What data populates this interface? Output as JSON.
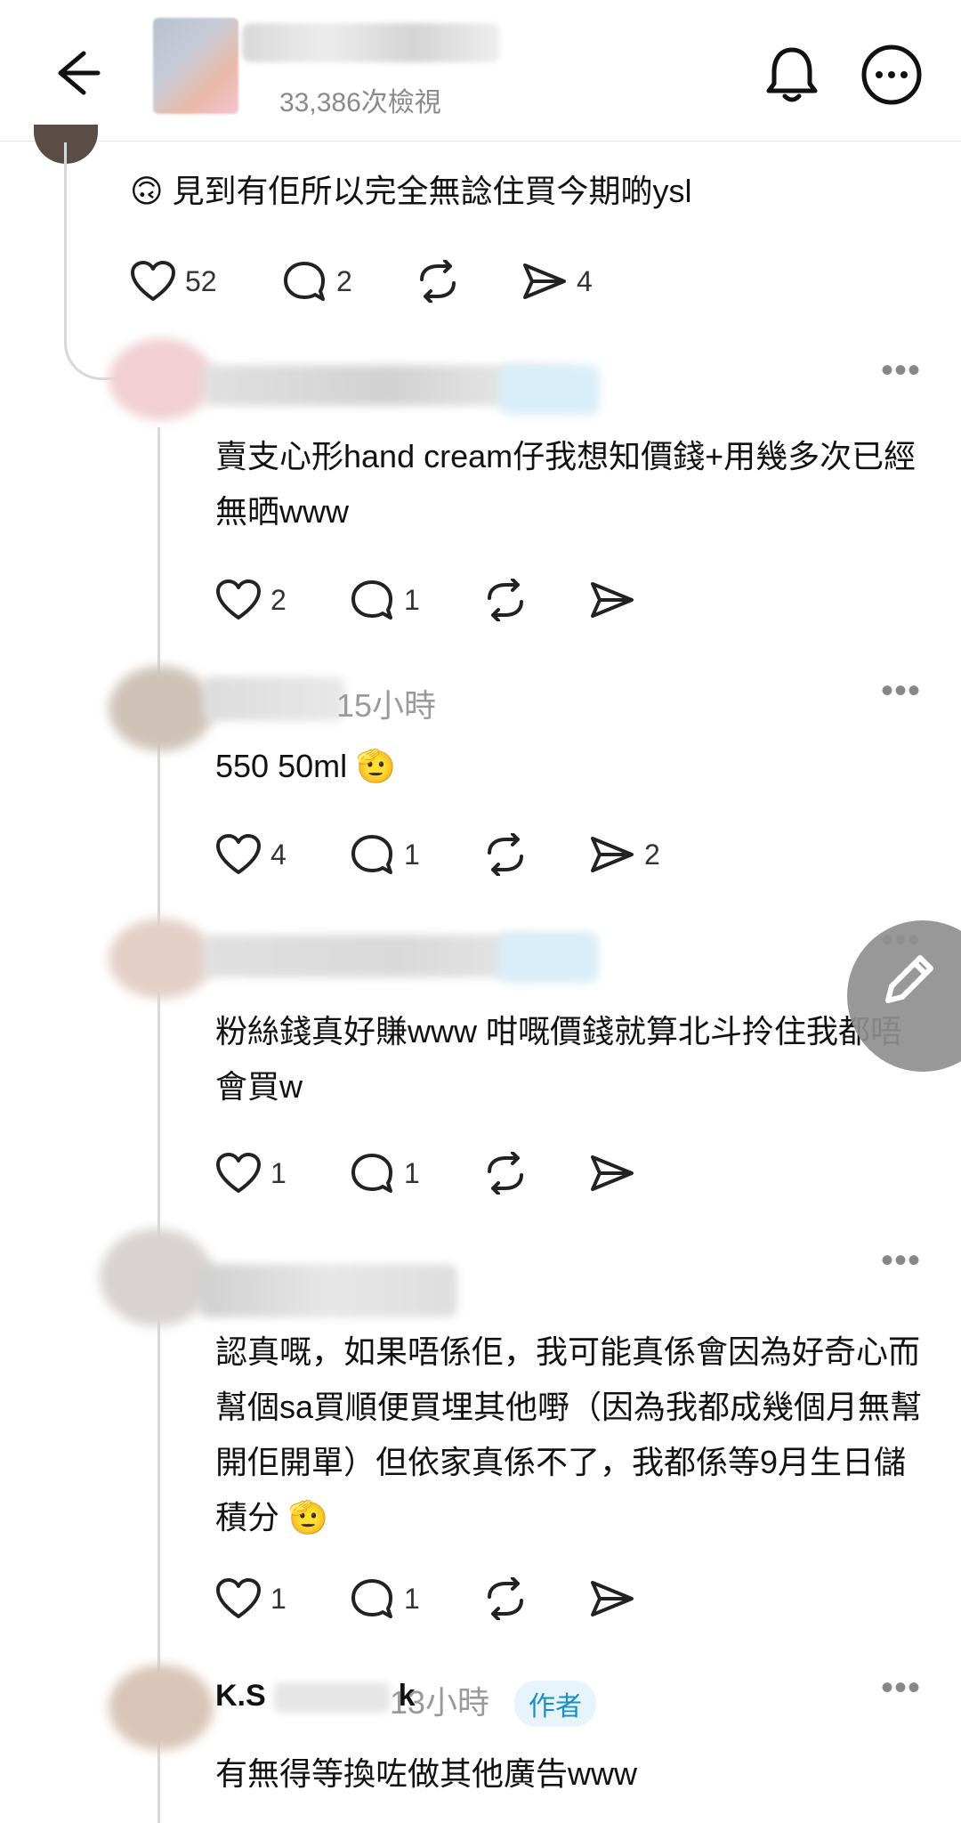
{
  "header": {
    "back_icon": "arrow-left-icon",
    "views": "33,386次檢視",
    "bell_icon": "bell-icon",
    "more_icon": "more-circle-icon"
  },
  "top_post": {
    "emoji": "🙃",
    "text": "見到有佢所以完全無諗住買今期啲ysl",
    "likes": "52",
    "replies": "2",
    "shares": "4"
  },
  "replies": [
    {
      "more_label": "•••",
      "text": "賣支心形hand cream仔我想知價錢+用幾多次已經無晒www",
      "likes": "2",
      "replies": "1",
      "shares": ""
    },
    {
      "time": "15小時",
      "more_label": "•••",
      "text": "550 50ml",
      "emoji": "🫡",
      "likes": "4",
      "replies": "1",
      "shares": "2"
    },
    {
      "more_label": "•••",
      "text": "粉絲錢真好賺www 咁嘅價錢就算北斗拎住我都唔會買w",
      "likes": "1",
      "replies": "1",
      "shares": ""
    },
    {
      "more_label": "•••",
      "text": "認真嘅，如果唔係佢，我可能真係會因為好奇心而幫個sa買順便買埋其他嘢（因為我都成幾個月無幫開佢開單）但依家真係不了，我都係等9月生日儲積分",
      "emoji": "🫡",
      "likes": "1",
      "replies": "1",
      "shares": ""
    },
    {
      "name_partial": "K.S",
      "name_end": "k",
      "time": "13小時",
      "badge": "作者",
      "more_label": "•••",
      "text": "有無得等換咗做其他廣告www"
    }
  ],
  "fab": {
    "icon": "pencil-icon"
  }
}
